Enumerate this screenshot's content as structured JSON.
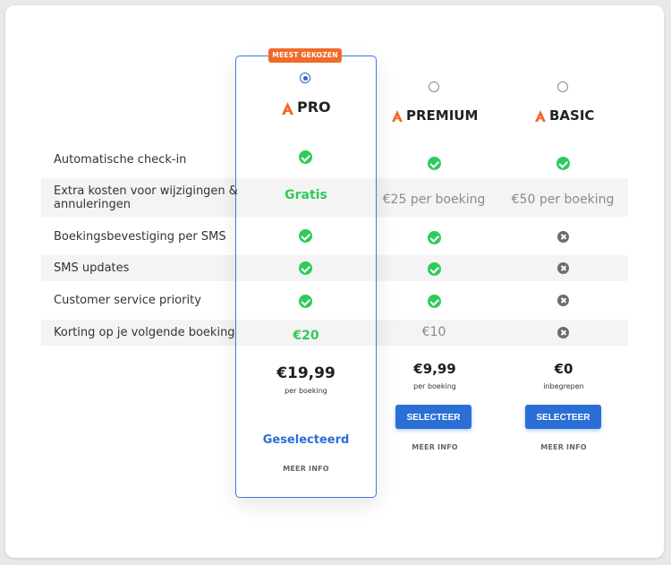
{
  "badge": "MEEST GEKOZEN",
  "colors": {
    "accent": "#2a6fd6",
    "orange": "#f06a2a",
    "green": "#2fcb5a",
    "cross": "#6c6c6c"
  },
  "plans": [
    {
      "name": "PRO",
      "selected": true,
      "price": "€19,99",
      "price_sub": "per boeking",
      "action": "Geselecteerd",
      "more": "MEER INFO"
    },
    {
      "name": "PREMIUM",
      "selected": false,
      "price": "€9,99",
      "price_sub": "per boeking",
      "action": "SELECTEER",
      "more": "MEER INFO"
    },
    {
      "name": "BASIC",
      "selected": false,
      "price": "€0",
      "price_sub": "inbegrepen",
      "action": "SELECTEER",
      "more": "MEER INFO"
    }
  ],
  "features": [
    {
      "label": "Automatische check-in",
      "values": [
        "check",
        "check",
        "check"
      ]
    },
    {
      "label": "Extra kosten voor wijzigingen & annuleringen",
      "label_line1": "Extra kosten voor wijzigingen &",
      "label_line2": "annuleringen",
      "values": [
        "Gratis",
        "€25 per boeking",
        "€50 per boeking"
      ]
    },
    {
      "label": "Boekingsbevestiging per SMS",
      "values": [
        "check",
        "check",
        "cross"
      ]
    },
    {
      "label": "SMS updates",
      "values": [
        "check",
        "check",
        "cross"
      ]
    },
    {
      "label": "Customer service priority",
      "values": [
        "check",
        "check",
        "cross"
      ]
    },
    {
      "label": "Korting op je volgende boeking",
      "values": [
        "€20",
        "€10",
        "cross"
      ]
    }
  ]
}
